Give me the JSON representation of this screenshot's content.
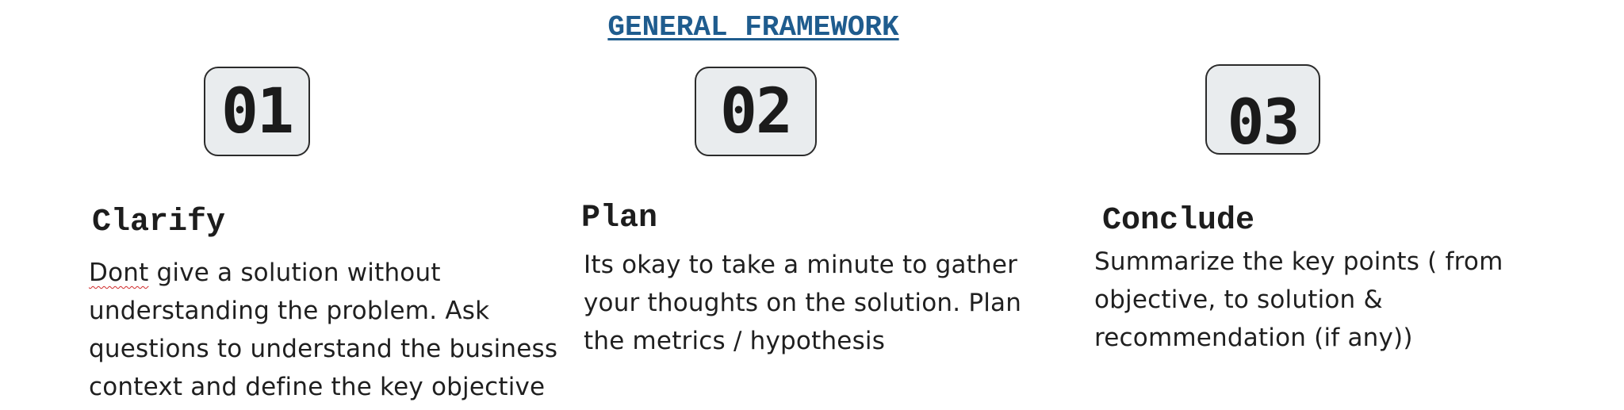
{
  "title": "GENERAL FRAMEWORK",
  "steps": [
    {
      "number": "01",
      "heading": "Clarify",
      "text_first_word": "Dont",
      "text_rest": " give a solution without understanding the problem. Ask questions to understand the business context and define the key objective"
    },
    {
      "number": "02",
      "heading": "Plan",
      "text": "Its okay to take a minute to gather your thoughts on the solution. Plan the metrics / hypothesis"
    },
    {
      "number": "03",
      "heading": "Conclude",
      "text": "Summarize the key points ( from objective, to solution & recommendation (if any))"
    }
  ]
}
